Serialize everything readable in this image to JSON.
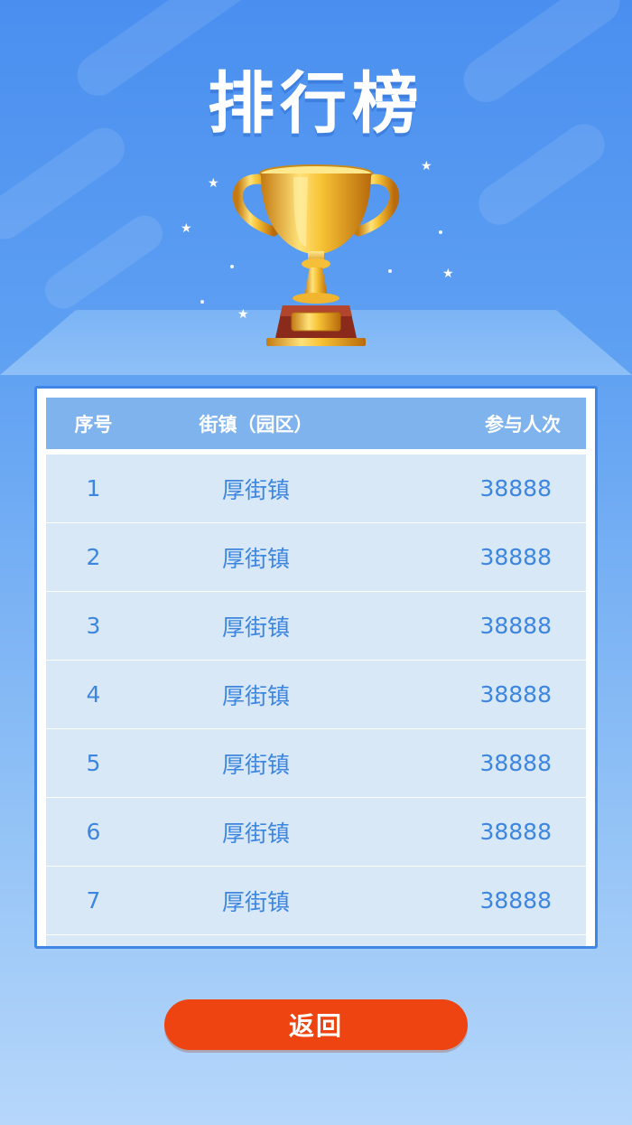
{
  "page": {
    "title": "排行榜"
  },
  "table": {
    "headers": {
      "index": "序号",
      "town": "街镇（园区）",
      "count": "参与人次"
    },
    "rows": [
      {
        "index": "1",
        "town": "厚街镇",
        "count": "38888"
      },
      {
        "index": "2",
        "town": "厚街镇",
        "count": "38888"
      },
      {
        "index": "3",
        "town": "厚街镇",
        "count": "38888"
      },
      {
        "index": "4",
        "town": "厚街镇",
        "count": "38888"
      },
      {
        "index": "5",
        "town": "厚街镇",
        "count": "38888"
      },
      {
        "index": "6",
        "town": "厚街镇",
        "count": "38888"
      },
      {
        "index": "7",
        "town": "厚街镇",
        "count": "38888"
      }
    ]
  },
  "actions": {
    "back_label": "返回"
  },
  "colors": {
    "background_top": "#4a8ff0",
    "table_border": "#3f86e6",
    "header_bg": "#7fb3ee",
    "row_bg": "#d9e8f7",
    "row_text": "#3d86df",
    "button": "#ee4411"
  },
  "icons": {
    "trophy": "trophy-icon",
    "star": "star-icon"
  }
}
